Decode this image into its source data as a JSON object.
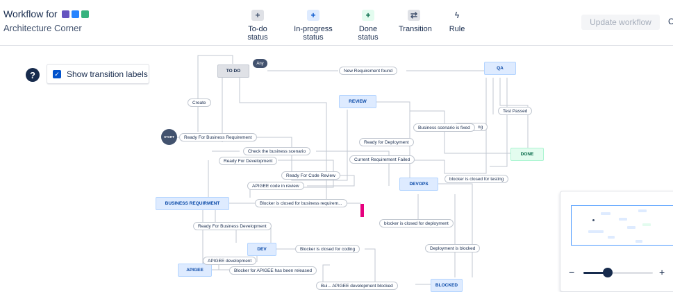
{
  "header": {
    "title": "Workflow for",
    "subtitle": "Architecture Corner",
    "badges": [
      {
        "name": "purple-badge-icon",
        "color": "#6554c0"
      },
      {
        "name": "blue-badge-icon",
        "color": "#2684ff"
      },
      {
        "name": "green-badge-icon",
        "color": "#36b37e"
      }
    ],
    "tools": [
      {
        "label": "To-do status",
        "icon": "+",
        "color": "#dfe1e6"
      },
      {
        "label": "In-progress status",
        "icon": "+",
        "color": "#deebff"
      },
      {
        "label": "Done status",
        "icon": "+",
        "color": "#e3fcef"
      },
      {
        "label": "Transition",
        "icon": "⇄",
        "color": "#ffffff"
      },
      {
        "label": "Rule",
        "icon": "ϟ",
        "color": "#ffffff"
      }
    ],
    "update_button": "Update workflow",
    "cut_off": "C"
  },
  "controls": {
    "help": "?",
    "show_transition_labels": "Show transition labels",
    "checked": true
  },
  "statuses": {
    "todo": "TO DO",
    "review": "REVIEW",
    "qa": "QA",
    "done": "DONE",
    "devops": "DEVOPS",
    "business": "BUSINESS REQUIRMENT",
    "dev": "DEV",
    "apigee": "APIGEE",
    "blocked": "BLOCKED"
  },
  "special": {
    "start": "START",
    "any": "Any"
  },
  "transitions": {
    "create": "Create",
    "new_req": "New Requirement found",
    "test_passed": "Test Passed",
    "biz_fixed": "Business scenario is fixed",
    "hidden_ng": "ng",
    "ready_biz_req": "Ready For Business Requirement",
    "ready_deploy": "Ready for Deployment",
    "check_scenario": "Check the business scenario",
    "ready_dev": "Ready For Development",
    "current_req_failed": "Current Requirement Failed",
    "ready_code_review": "Ready For Code Review",
    "blocker_testing": "blocker is closed for testing",
    "apigee_review": "APIGEE code in review",
    "blocker_biz": "Blocker is closed for business requirem...",
    "blocker_deploy": "blocker is closed for deployment",
    "ready_biz_dev": "Ready For Business Development",
    "deployment_blocked": "Deployment is blocked",
    "blocker_coding": "Blocker is closed for coding",
    "apigee_dev": "APIGEE development",
    "blocker_apigee": "Blocker for APIGEE has been released",
    "apigee_blocked": "Bui... APIGEE development blocked"
  },
  "minimap": {
    "zoom_out": "−",
    "zoom_in": "+",
    "zoom_level": 0.35
  }
}
